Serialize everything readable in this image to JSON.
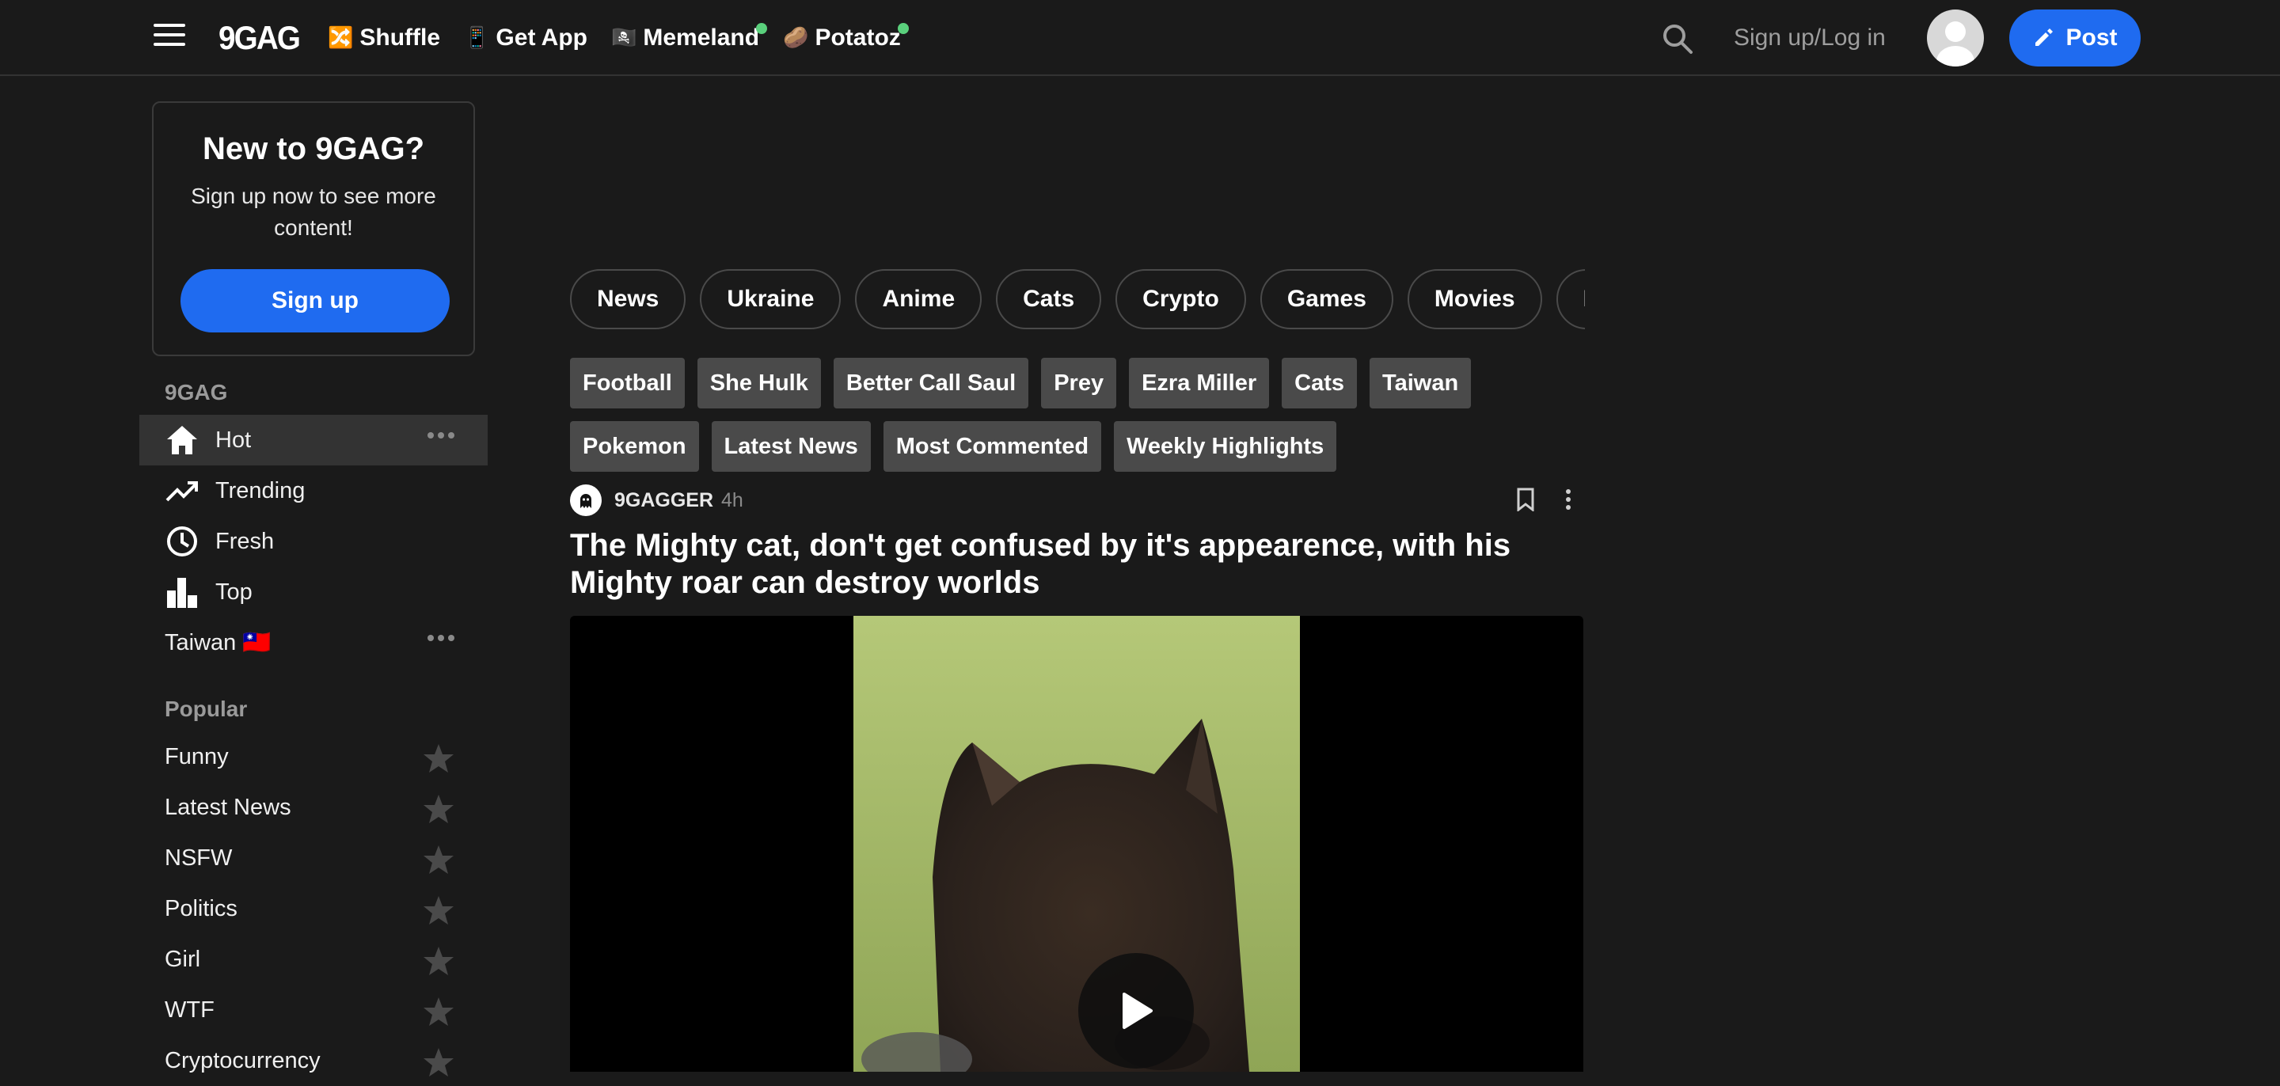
{
  "header": {
    "logo": "9GAG",
    "nav": [
      {
        "label": "Shuffle",
        "emoji": "🔀",
        "dot": false
      },
      {
        "label": "Get App",
        "emoji": "📱",
        "dot": false
      },
      {
        "label": "Memeland",
        "emoji": "🏴‍☠️",
        "dot": true
      },
      {
        "label": "Potatoz",
        "emoji": "🥔",
        "dot": true
      }
    ],
    "login": "Sign up/Log in",
    "post": "Post"
  },
  "signup_card": {
    "title": "New to 9GAG?",
    "subtitle": "Sign up now to see more content!",
    "button": "Sign up"
  },
  "sidebar": {
    "section_label": "9GAG",
    "items": [
      {
        "label": "Hot",
        "icon": "home-icon"
      },
      {
        "label": "Trending",
        "icon": "trending-icon"
      },
      {
        "label": "Fresh",
        "icon": "clock-icon"
      },
      {
        "label": "Top",
        "icon": "bar-chart-icon"
      },
      {
        "label": "Taiwan 🇹🇼",
        "icon": ""
      }
    ],
    "popular_label": "Popular",
    "popular": [
      "Funny",
      "Latest News",
      "NSFW",
      "Politics",
      "Girl",
      "WTF",
      "Cryptocurrency"
    ]
  },
  "pills": [
    "News",
    "Ukraine",
    "Anime",
    "Cats",
    "Crypto",
    "Games",
    "Movies",
    "Lif"
  ],
  "tags_row1": [
    "Football",
    "She Hulk",
    "Better Call Saul",
    "Prey",
    "Ezra Miller",
    "Cats",
    "Taiwan"
  ],
  "tags_row2": [
    "Pokemon",
    "Latest News",
    "Most Commented",
    "Weekly Highlights"
  ],
  "post": {
    "author": "9GAGGER",
    "time": "4h",
    "title": "The Mighty cat, don't get confused by it's appearence, with his Mighty roar can destroy worlds"
  },
  "colors": {
    "background": "#1a1a1a",
    "accent": "#1f6bf0",
    "tag_bg": "#4a4a4a",
    "online_dot": "#5ad07c"
  }
}
